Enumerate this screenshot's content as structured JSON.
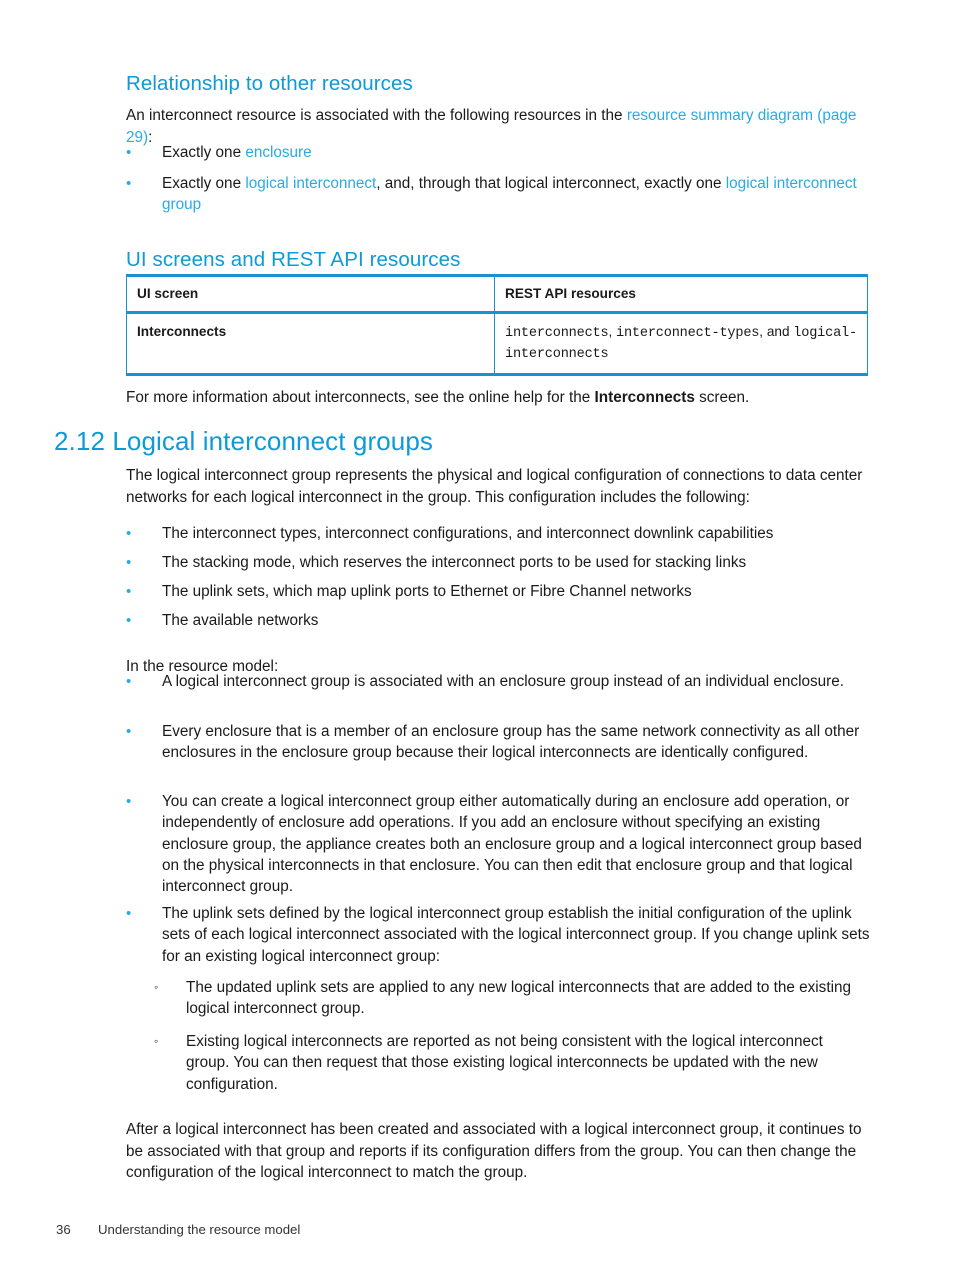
{
  "document": {
    "footer": {
      "page_number": "36",
      "chapter_title": "Understanding the resource model"
    }
  },
  "section_relationship": {
    "heading": "Relationship to other resources",
    "intro": {
      "before_link": "An interconnect resource is associated with the following resources in the ",
      "link": "resource summary diagram (page 29)",
      "after_link": ":"
    },
    "bullets": [
      {
        "marker": "•",
        "parts": [
          {
            "text": "Exactly one ",
            "style": "plain"
          },
          {
            "text": "enclosure",
            "style": "link"
          }
        ]
      },
      {
        "marker": "•",
        "parts": [
          {
            "text": "Exactly one ",
            "style": "plain"
          },
          {
            "text": "logical interconnect",
            "style": "link"
          },
          {
            "text": ", and, through that logical interconnect, exactly one ",
            "style": "plain"
          },
          {
            "text": "logical interconnect group",
            "style": "link"
          }
        ]
      }
    ]
  },
  "section_ui_rest": {
    "heading": "UI screens and REST API resources",
    "table": {
      "columns": [
        "UI screen",
        "REST API resources"
      ],
      "rows": [
        {
          "ui_screen": "Interconnects",
          "rest_api_parts": [
            {
              "text": "interconnects",
              "style": "mono"
            },
            {
              "text": ", ",
              "style": "plain"
            },
            {
              "text": "interconnect-types",
              "style": "mono"
            },
            {
              "text": ", and ",
              "style": "plain"
            },
            {
              "text": "logical-interconnects",
              "style": "mono"
            }
          ]
        }
      ]
    },
    "note": {
      "before_bold": "For more information about interconnects, see the online help for the ",
      "bold": "Interconnects",
      "after_bold": " screen."
    }
  },
  "section_lig": {
    "number": "2.12",
    "heading": "2.12 Logical interconnect groups",
    "intro": "The logical interconnect group represents the physical and logical configuration of connections to data center networks for each logical interconnect in the group. This configuration includes the following:",
    "config_bullets": [
      {
        "marker": "•",
        "text": "The interconnect types, interconnect configurations, and interconnect downlink capabilities"
      },
      {
        "marker": "•",
        "text": "The stacking mode, which reserves the interconnect ports to be used for stacking links"
      },
      {
        "marker": "•",
        "text": "The uplink sets, which map uplink ports to Ethernet or Fibre Channel networks"
      },
      {
        "marker": "•",
        "text": "The available networks"
      }
    ],
    "resource_model_lead": "In the resource model:",
    "resource_model_bullets": [
      {
        "marker": "•",
        "text": "A logical interconnect group is associated with an enclosure group instead of an individual enclosure."
      },
      {
        "marker": "•",
        "text": "Every enclosure that is a member of an enclosure group has the same network connectivity as all other enclosures in the enclosure group because their logical interconnects are identically configured."
      },
      {
        "marker": "•",
        "text": "You can create a logical interconnect group either automatically during an enclosure add operation, or independently of enclosure add operations. If you add an enclosure without specifying an existing enclosure group, the appliance creates both an enclosure group and a logical interconnect group based on the physical interconnects in that enclosure. You can then edit that enclosure group and that logical interconnect group."
      },
      {
        "marker": "•",
        "text": "The uplink sets defined by the logical interconnect group establish the initial configuration of the uplink sets of each logical interconnect associated with the logical interconnect group. If you change uplink sets for an existing logical interconnect group:"
      }
    ],
    "sub_bullets": [
      {
        "marker": "◦",
        "text": "The updated uplink sets are applied to any new logical interconnects that are added to the existing logical interconnect group."
      },
      {
        "marker": "◦",
        "text": "Existing logical interconnects are reported as not being consistent with the logical interconnect group. You can then request that those existing logical interconnects be updated with the new configuration."
      }
    ],
    "closing": "After a logical interconnect has been created and associated with a logical interconnect group, it continues to be associated with that group and reports if its configuration differs from the group. You can then change the configuration of the logical interconnect to match the group."
  },
  "colors": {
    "heading_blue": "#0c9ad8",
    "link_blue": "#29abe2",
    "table_border_blue": "#1992d4",
    "body_text": "#1a1a1a"
  }
}
